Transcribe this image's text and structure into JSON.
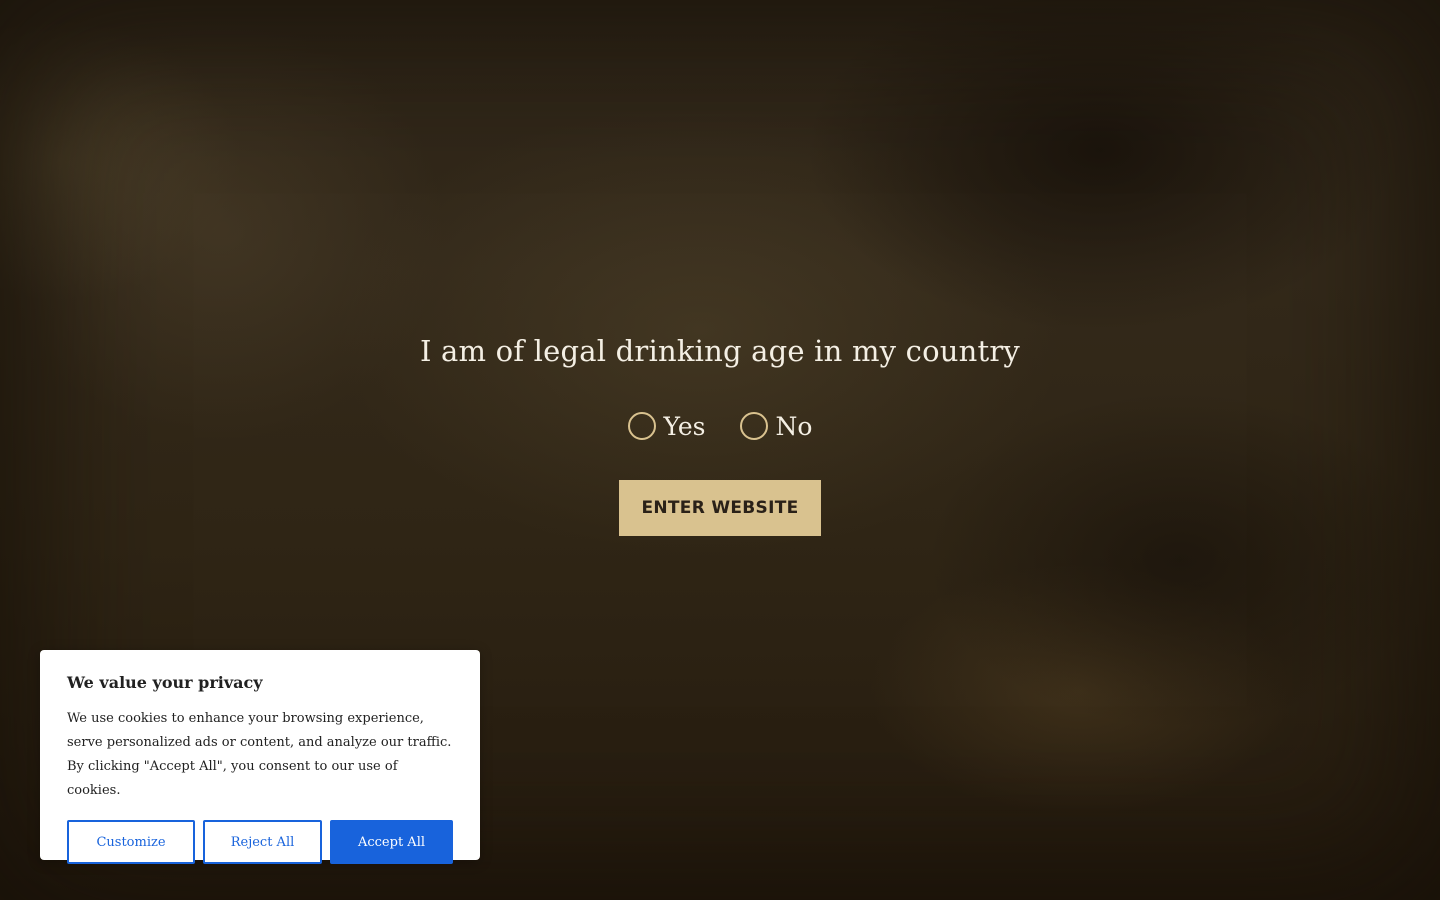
{
  "age_gate": {
    "title": "I am of legal drinking age in my country",
    "options": [
      {
        "label": "Yes"
      },
      {
        "label": "No"
      }
    ],
    "enter_label": "ENTER WEBSITE"
  },
  "cookie_banner": {
    "title": "We value your privacy",
    "text": "We use cookies to enhance your browsing experience, serve personalized ads or content, and analyze our traffic. By clicking \"Accept All\", you consent to our use of cookies.",
    "customize_label": "Customize",
    "reject_label": "Reject All",
    "accept_label": "Accept All"
  },
  "colors": {
    "accent_gold": "#d9c28f",
    "cookie_button_blue": "#1863dc",
    "overlay_text": "#f4efe4"
  }
}
